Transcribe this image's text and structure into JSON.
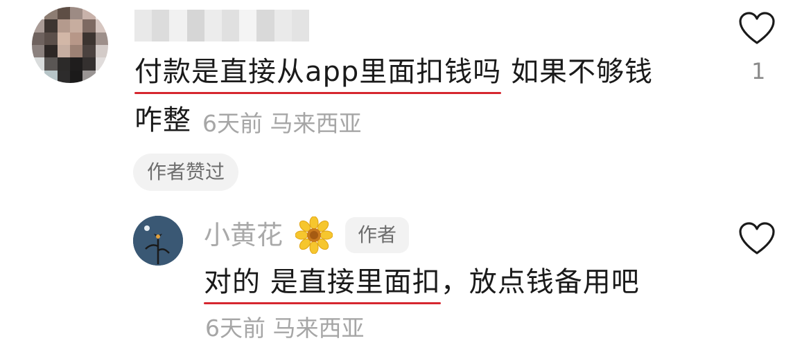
{
  "comment": {
    "text_part1": "付款是直接从app里面扣钱吗",
    "text_part2": " 如果不够钱",
    "text_line2": "咋整",
    "time": "6天前",
    "location": "马来西亚",
    "author_liked_badge": "作者赞过",
    "like_count": "1",
    "avatar_icon": "blurred-avatar",
    "username_icon": "blurred-username"
  },
  "reply": {
    "username": "小黄花",
    "username_emoji": "sunflower-icon",
    "author_badge": "作者",
    "text_part1": "对的 是直接里面扣",
    "text_part2": "，放点钱备用吧",
    "time": "6天前",
    "location": "马来西亚",
    "avatar_icon": "flower-avatar"
  },
  "colors": {
    "underline": "#d6262f",
    "meta_text": "#a6a6a6",
    "badge_bg": "#f2f2f2"
  }
}
